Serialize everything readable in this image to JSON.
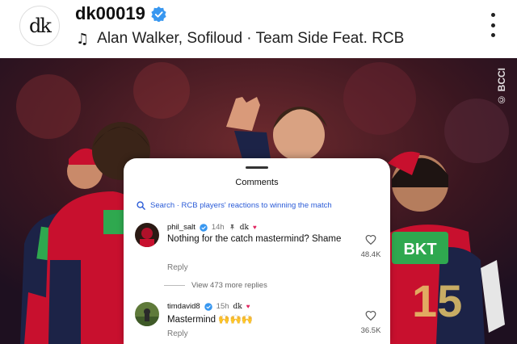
{
  "post": {
    "avatar_text": "dk",
    "username": "dk00019",
    "audio": "Alan Walker, Sofiloud · Team Side Feat. RCB"
  },
  "photo": {
    "watermark": "© BCCI"
  },
  "comments_sheet": {
    "title": "Comments",
    "search_text": "Search · RCB players' reactions to winning the match",
    "comments": [
      {
        "username": "phil_salt",
        "time": "14h",
        "text": "Nothing for the catch mastermind? Shame",
        "reply": "Reply",
        "likes": "48.4K"
      },
      {
        "username": "timdavid8",
        "time": "15h",
        "text": "Mastermind 🙌🙌🙌",
        "reply": "Reply",
        "likes": "36.5K"
      }
    ],
    "view_replies": "View 473 more replies"
  },
  "colors": {
    "verified_blue": "#3897f0",
    "search_blue": "#2a5bd7",
    "jersey_red": "#c8102e",
    "jersey_navy": "#1c2347",
    "sponsor_green": "#2fa84f"
  }
}
